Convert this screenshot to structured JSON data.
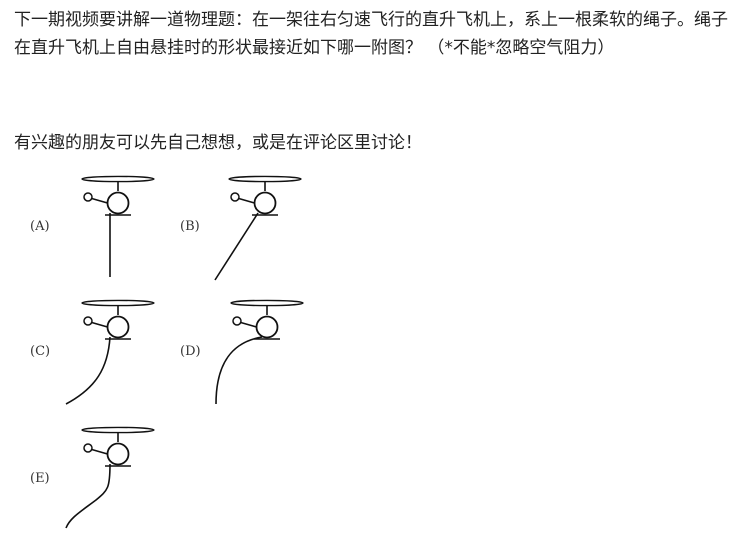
{
  "post": {
    "question": "下一期视频要讲解一道物理题：在一架往右匀速飞行的直升飞机上，系上一根柔软的绳子。绳子在直升飞机上自由悬挂时的形状最接近如下哪一附图？ （*不能*忽略空气阻力）",
    "invite": "有兴趣的朋友可以先自己想想，或是在评论区里讨论！"
  },
  "figure": {
    "options": [
      {
        "label": "(A)",
        "shape": "vertical-straight"
      },
      {
        "label": "(B)",
        "shape": "straight-slanted-back"
      },
      {
        "label": "(C)",
        "shape": "curve-back-steep-bottom"
      },
      {
        "label": "(D)",
        "shape": "curve-back-vertical-bottom"
      },
      {
        "label": "(E)",
        "shape": "s-curve"
      }
    ]
  }
}
